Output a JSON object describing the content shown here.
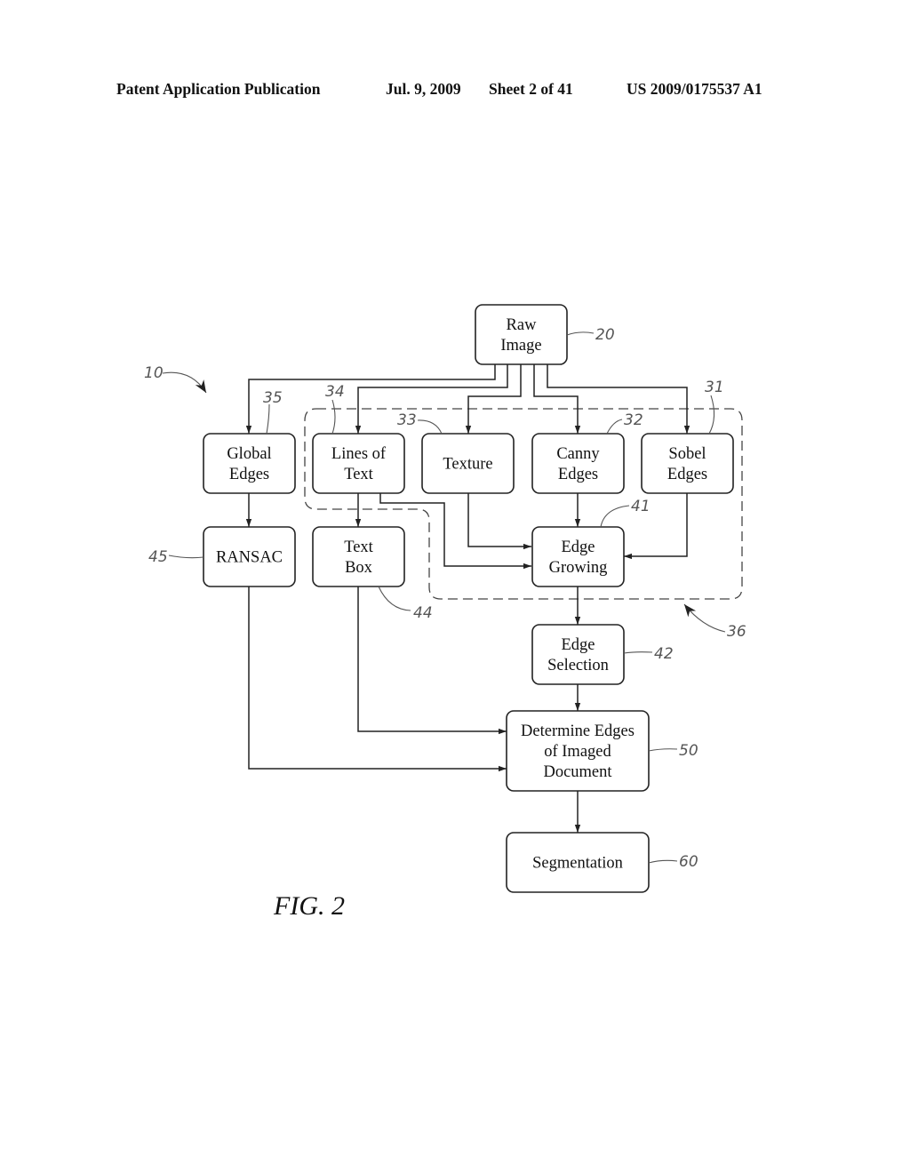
{
  "header": {
    "publication": "Patent Application Publication",
    "date": "Jul. 9, 2009",
    "sheet": "Sheet 2 of 41",
    "number": "US 2009/0175537 A1"
  },
  "figure": {
    "label": "FIG.  2",
    "system_ref": "10",
    "group_ref": "36"
  },
  "nodes": {
    "raw_image": {
      "lines": [
        "Raw",
        "Image"
      ],
      "ref": "20"
    },
    "global_edges": {
      "lines": [
        "Global",
        "Edges"
      ],
      "ref": "35"
    },
    "lines_of_text": {
      "lines": [
        "Lines of",
        "Text"
      ],
      "ref": "34"
    },
    "texture": {
      "lines": [
        "Texture"
      ],
      "ref": "33"
    },
    "canny_edges": {
      "lines": [
        "Canny",
        "Edges"
      ],
      "ref": "32"
    },
    "sobel_edges": {
      "lines": [
        "Sobel",
        "Edges"
      ],
      "ref": "31"
    },
    "ransac": {
      "lines": [
        "RANSAC"
      ],
      "ref": "45"
    },
    "text_box": {
      "lines": [
        "Text",
        "Box"
      ],
      "ref": "44"
    },
    "edge_growing": {
      "lines": [
        "Edge",
        "Growing"
      ],
      "ref": "41"
    },
    "edge_selection": {
      "lines": [
        "Edge",
        "Selection"
      ],
      "ref": "42"
    },
    "determine_edges": {
      "lines": [
        "Determine Edges",
        "of Imaged",
        "Document"
      ],
      "ref": "50"
    },
    "segmentation": {
      "lines": [
        "Segmentation"
      ],
      "ref": "60"
    }
  },
  "edges": [
    {
      "from": "raw_image",
      "to": "global_edges"
    },
    {
      "from": "raw_image",
      "to": "lines_of_text"
    },
    {
      "from": "raw_image",
      "to": "texture"
    },
    {
      "from": "raw_image",
      "to": "canny_edges"
    },
    {
      "from": "raw_image",
      "to": "sobel_edges"
    },
    {
      "from": "global_edges",
      "to": "ransac"
    },
    {
      "from": "lines_of_text",
      "to": "text_box"
    },
    {
      "from": "lines_of_text",
      "to": "edge_growing"
    },
    {
      "from": "texture",
      "to": "edge_growing"
    },
    {
      "from": "canny_edges",
      "to": "edge_growing"
    },
    {
      "from": "sobel_edges",
      "to": "edge_growing"
    },
    {
      "from": "edge_growing",
      "to": "edge_selection"
    },
    {
      "from": "edge_selection",
      "to": "determine_edges"
    },
    {
      "from": "text_box",
      "to": "determine_edges"
    },
    {
      "from": "ransac",
      "to": "determine_edges"
    },
    {
      "from": "determine_edges",
      "to": "segmentation"
    }
  ]
}
